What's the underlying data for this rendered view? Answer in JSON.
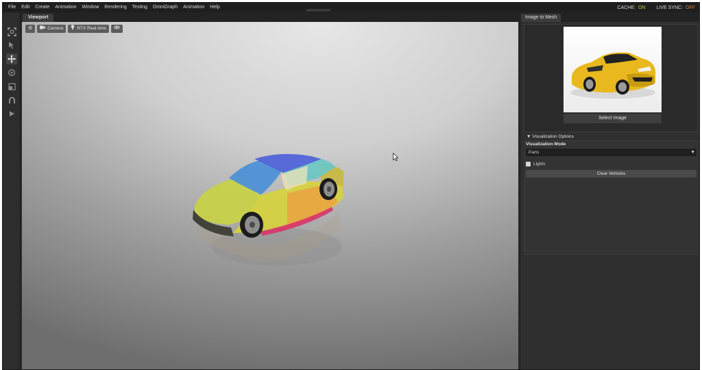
{
  "menu": [
    "File",
    "Edit",
    "Create",
    "Animation",
    "Window",
    "Rendering",
    "Testing",
    "OmniGraph",
    "Animation",
    "Help"
  ],
  "status": {
    "cache_label": "CACHE:",
    "cache_value": "ON",
    "live_sync_label": "LIVE SYNC:",
    "live_sync_value": "OFF"
  },
  "toolbar": {
    "icons": [
      "frame-select-icon",
      "arrow-select-icon",
      "move-icon",
      "rotate-icon",
      "scale-icon",
      "snap-magnet-icon",
      "play-icon"
    ],
    "active_index": 2
  },
  "viewport": {
    "tab_label": "Viewport",
    "controls": {
      "settings_icon": "gear-icon",
      "camera_label": "Camera",
      "render_label": "RTX Real-time",
      "eye_icon": "eye-icon"
    },
    "car_segment_colors": {
      "hood": "#c8d245",
      "windshield": "#4a8fd8",
      "roof": "#4e62d8",
      "rear_window": "#6bc7c4",
      "side_front": "#d6d13e",
      "side_rear": "#e8a642",
      "trunk": "#c8b840",
      "rocker": "#d8366a",
      "bumper": "#3a3a32"
    }
  },
  "panel": {
    "tab_label": "Image to Mesh",
    "select_image_label": "Select Image",
    "section_title": "Visualization Options",
    "visualization_mode_label": "Visualization Mode",
    "visualization_mode_value": "Parts",
    "lights_label": "Lights",
    "lights_checked": false,
    "clear_button_label": "Clear Vehicles"
  },
  "colors": {
    "background": "#2b2b2b",
    "menubar": "#1f1f1f",
    "status_on": "#c8c830",
    "status_off": "#d07a3a",
    "preview_car": "#e8b81e"
  }
}
